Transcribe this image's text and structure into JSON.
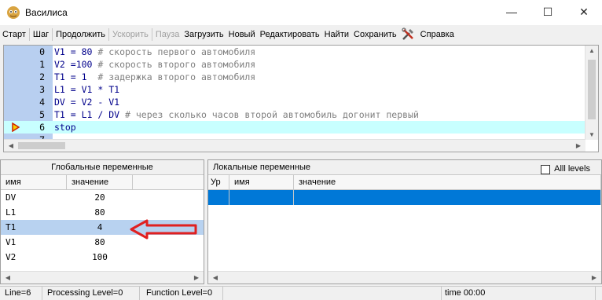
{
  "window": {
    "title": "Василиса",
    "min_glyph": "—",
    "max_glyph": "☐",
    "close_glyph": "✕"
  },
  "menu": {
    "items": [
      {
        "label": "Старт",
        "enabled": true
      },
      {
        "label": "Шаг",
        "enabled": true
      },
      {
        "label": "Продолжить",
        "enabled": true
      },
      {
        "label": "Ускорить",
        "enabled": false
      },
      {
        "label": "Пауза",
        "enabled": false
      },
      {
        "label": "Загрузить",
        "enabled": true
      },
      {
        "label": "Новый",
        "enabled": true
      },
      {
        "label": "Редактировать",
        "enabled": true
      },
      {
        "label": "Найти",
        "enabled": true
      },
      {
        "label": "Сохранить",
        "enabled": true
      },
      {
        "label": "Справка",
        "enabled": true
      }
    ],
    "tools_icon": "tools-icon"
  },
  "editor": {
    "lines": [
      {
        "num": "0",
        "code": "V1 = 80 ",
        "comment": "# скорость первого автомобиля"
      },
      {
        "num": "1",
        "code": "V2 =100 ",
        "comment": "# скорость второго автомобиля"
      },
      {
        "num": "2",
        "code": "T1 = 1  ",
        "comment": "# задержка второго автомобиля"
      },
      {
        "num": "3",
        "code": "L1 = V1 * T1",
        "comment": ""
      },
      {
        "num": "4",
        "code": "DV = V2 - V1",
        "comment": ""
      },
      {
        "num": "5",
        "code": "T1 = L1 / DV ",
        "comment": "# через сколько часов второй автомобиль догонит первый"
      },
      {
        "num": "6",
        "code": "stop",
        "comment": "",
        "current": true
      },
      {
        "num": "7",
        "code": "",
        "comment": ""
      }
    ],
    "current_line_marker": "current-line-arrow-icon"
  },
  "globals": {
    "title": "Глобальные переменные",
    "col_name": "имя",
    "col_value": "значение",
    "rows": [
      {
        "name": "DV",
        "value": "20",
        "selected": false
      },
      {
        "name": "L1",
        "value": "80",
        "selected": false
      },
      {
        "name": "T1",
        "value": "4",
        "selected": true
      },
      {
        "name": "V1",
        "value": "80",
        "selected": false
      },
      {
        "name": "V2",
        "value": "100",
        "selected": false
      }
    ]
  },
  "locals": {
    "title": "Локальные переменные",
    "all_levels_label": "Alll levels",
    "all_levels_checked": false,
    "col_level": "Ур",
    "col_name": "имя",
    "col_value": "значение"
  },
  "status": {
    "line": "Line=6",
    "processing": "Processing Level=0",
    "function": "Function Level=0",
    "empty": "",
    "time": "time 00:00"
  },
  "annotation": {
    "arrow_color": "#e02020"
  }
}
